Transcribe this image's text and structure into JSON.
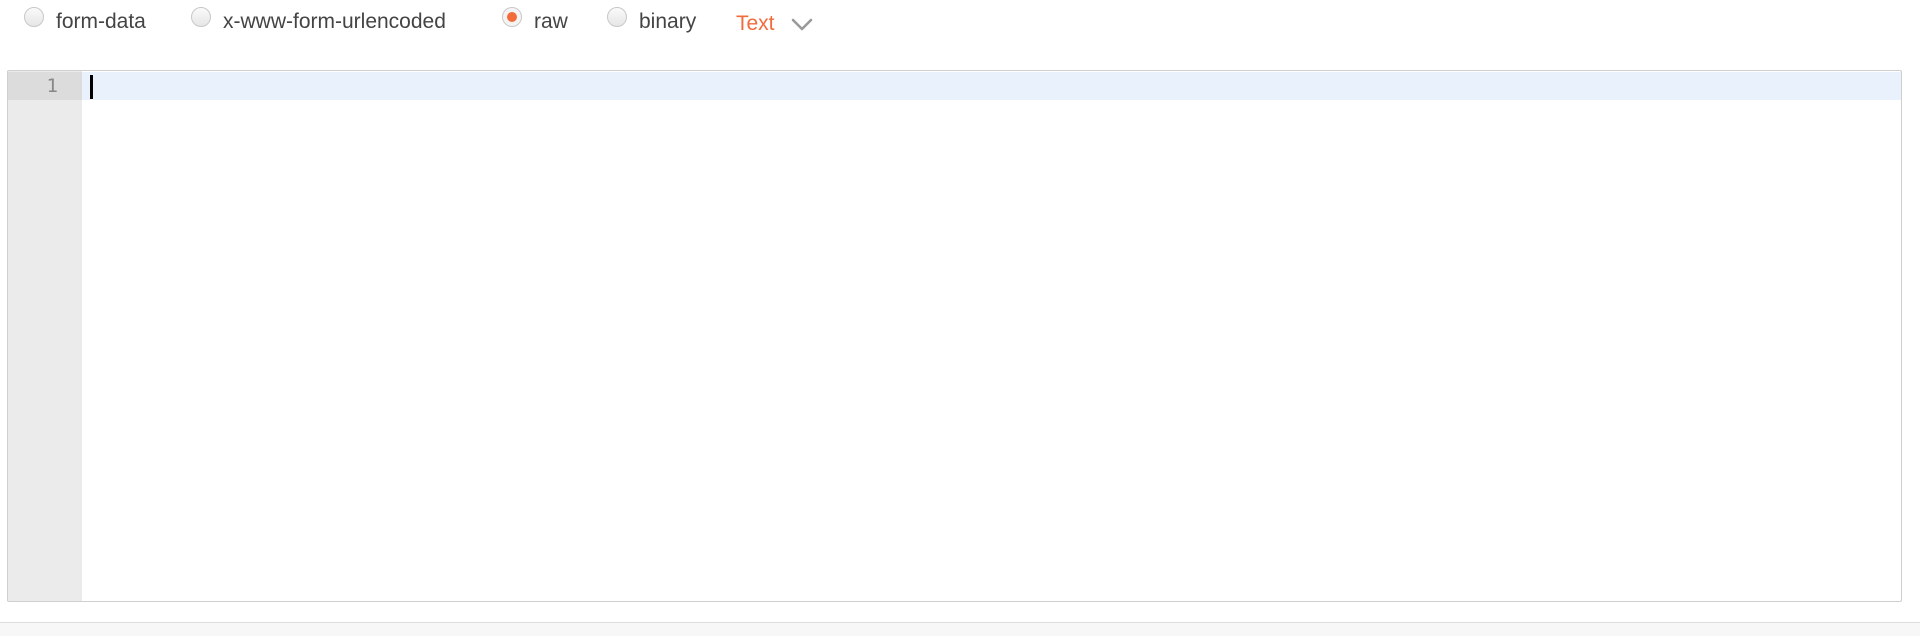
{
  "body_types": [
    {
      "label": "form-data",
      "checked": false
    },
    {
      "label": "x-www-form-urlencoded",
      "checked": false
    },
    {
      "label": "raw",
      "checked": true
    },
    {
      "label": "binary",
      "checked": false
    }
  ],
  "format": {
    "selected": "Text",
    "icon": "chevron-down-icon"
  },
  "editor": {
    "line_numbers": [
      "1"
    ],
    "content": ""
  },
  "colors": {
    "accent": "#f26b3a",
    "active_line": "#e8f1fc",
    "gutter": "#ebebeb"
  }
}
